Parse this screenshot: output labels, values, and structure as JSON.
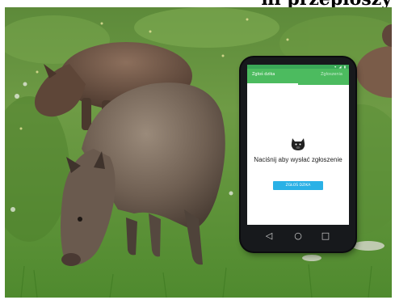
{
  "headline": {
    "text": "ni przepłoszy"
  },
  "phone_app": {
    "tabs": [
      {
        "label": "Zgłoś dzika"
      },
      {
        "label": "Zgłoszenia"
      }
    ],
    "status_icons": "▾ ◢ ▮",
    "icon": "boar-icon",
    "prompt_text": "Naciśnij aby wysłać zgłoszenie",
    "button_label": "ZGŁOŚ DZIKA",
    "nav_icons": [
      "back-icon",
      "home-icon",
      "recent-apps-icon"
    ],
    "colors": {
      "appbar": "#4cbb5f",
      "statusbar": "#3aa857",
      "button": "#2ab1e6",
      "phone_body": "#17191c"
    }
  }
}
